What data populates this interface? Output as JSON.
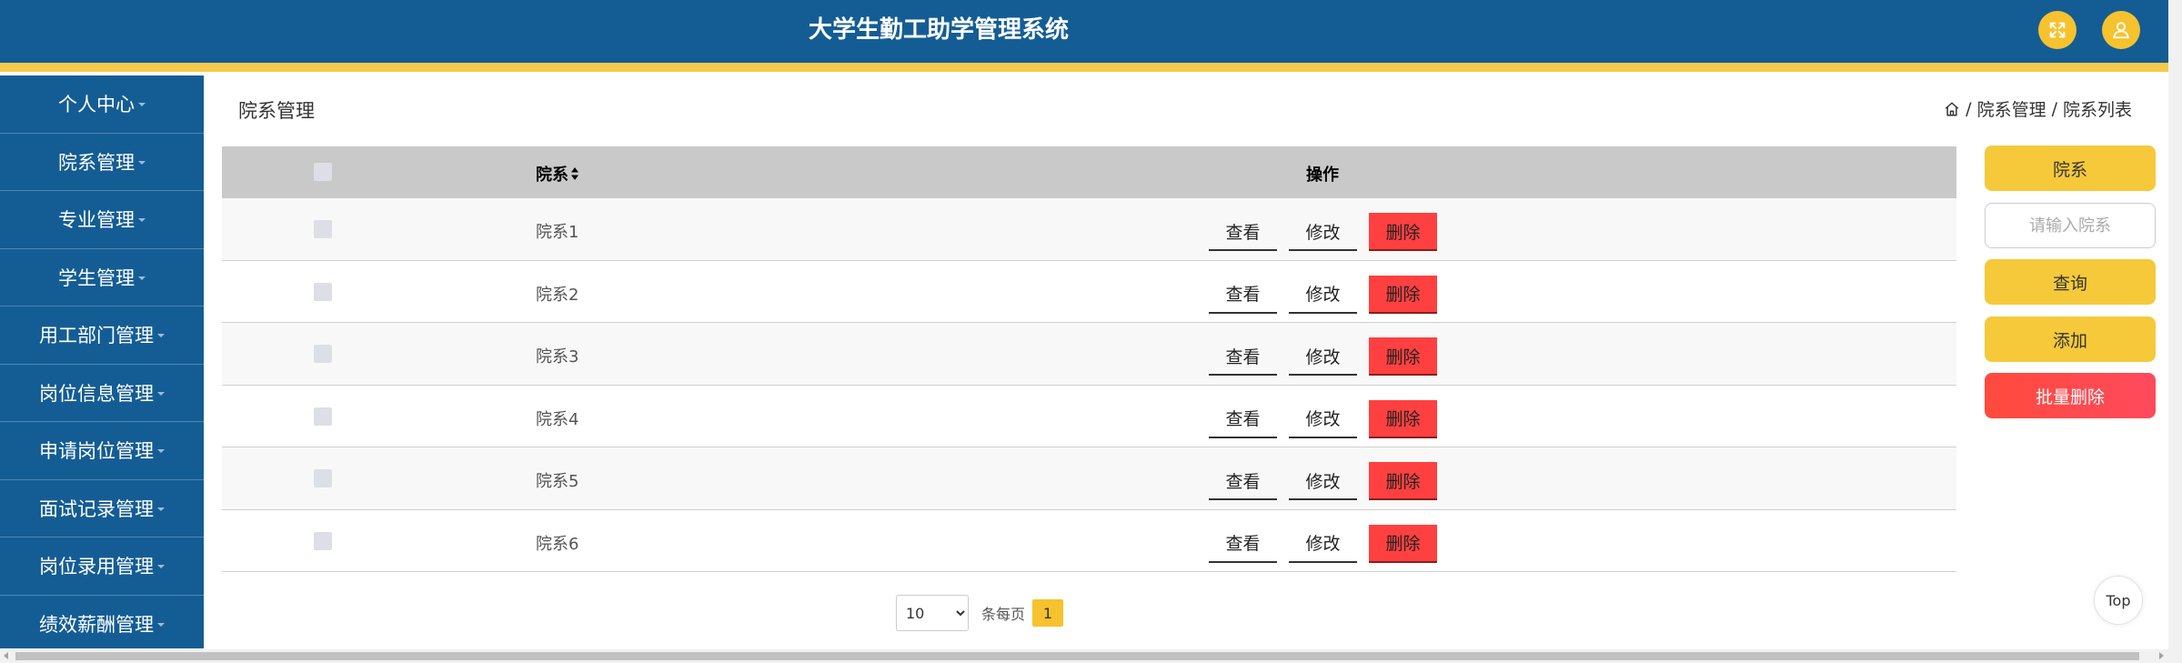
{
  "header": {
    "title": "大学生勤工助学管理系统",
    "fullscreen_icon": "fullscreen-icon",
    "user_icon": "user-icon"
  },
  "sidebar": {
    "items": [
      {
        "label": "个人中心"
      },
      {
        "label": "院系管理"
      },
      {
        "label": "专业管理"
      },
      {
        "label": "学生管理"
      },
      {
        "label": "用工部门管理"
      },
      {
        "label": "岗位信息管理"
      },
      {
        "label": "申请岗位管理"
      },
      {
        "label": "面试记录管理"
      },
      {
        "label": "岗位录用管理"
      },
      {
        "label": "绩效薪酬管理"
      }
    ]
  },
  "main": {
    "title": "院系管理",
    "breadcrumb": {
      "home_icon": "home-icon",
      "items": [
        "院系管理",
        "院系列表"
      ]
    },
    "table": {
      "headers": {
        "name": "院系",
        "op": "操作"
      },
      "rows": [
        {
          "name": "院系1"
        },
        {
          "name": "院系2"
        },
        {
          "name": "院系3"
        },
        {
          "name": "院系4"
        },
        {
          "name": "院系5"
        },
        {
          "name": "院系6"
        }
      ],
      "actions": {
        "view": "查看",
        "edit": "修改",
        "delete": "删除"
      }
    },
    "pagination": {
      "page_size": "10",
      "page_size_options": [
        "10"
      ],
      "per_page_label": "条每页",
      "current_page": "1"
    }
  },
  "right_panel": {
    "label": "院系",
    "input_placeholder": "请输入院系",
    "search_label": "查询",
    "add_label": "添加",
    "batch_delete_label": "批量删除"
  },
  "back_to_top": "Top",
  "colors": {
    "header_bg": "#145d94",
    "accent_yellow": "#f6c22e",
    "delete_red": "#ff4040"
  }
}
